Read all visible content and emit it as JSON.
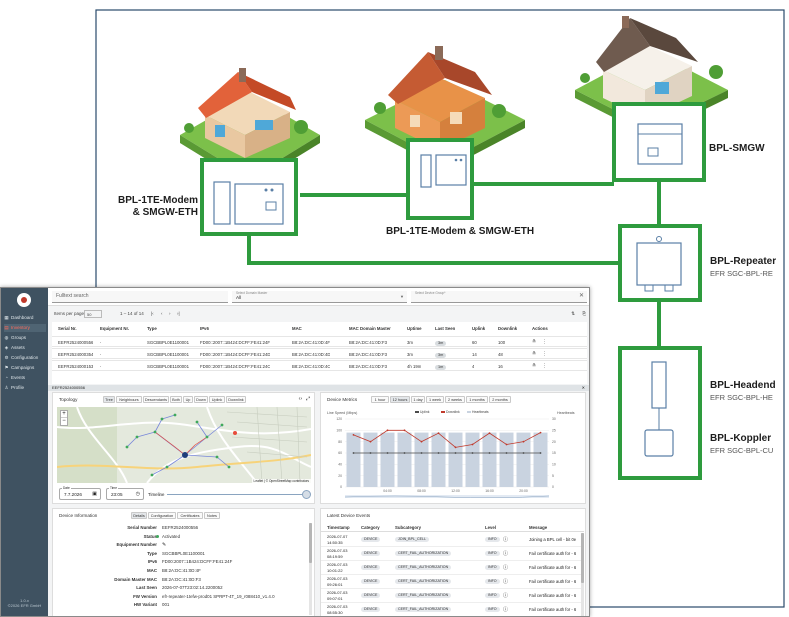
{
  "diagram": {
    "nodes": {
      "modem1": {
        "title_line1": "BPL-1TE-Modem",
        "title_line2": "& SMGW-ETH"
      },
      "modem2": {
        "title": "BPL-1TE-Modem & SMGW-ETH"
      },
      "smgw": {
        "title": "BPL-SMGW"
      },
      "repeater": {
        "title": "BPL-Repeater",
        "subtitle": "EFR SGC-BPL-RE"
      },
      "headend": {
        "title": "BPL-Headend",
        "subtitle": "EFR SGC-BPL-HE"
      },
      "koppler": {
        "title": "BPL-Koppler",
        "subtitle": "EFR SGC-BPL-CU"
      }
    },
    "colors": {
      "link": "#2e9b3e",
      "frame": "#2a4a6b"
    }
  },
  "app": {
    "sidebar": {
      "logo": "app-logo",
      "items": [
        {
          "label": "Dashboard",
          "icon": "dashboard-icon",
          "glyph": "▦"
        },
        {
          "label": "Inventory",
          "icon": "inventory-icon",
          "glyph": "▤"
        },
        {
          "label": "Groups",
          "icon": "groups-icon",
          "glyph": "◍"
        },
        {
          "label": "Assets",
          "icon": "assets-icon",
          "glyph": "◈"
        },
        {
          "label": "Configuration",
          "icon": "configuration-icon",
          "glyph": "⚙"
        },
        {
          "label": "Campaigns",
          "icon": "campaigns-icon",
          "glyph": "⚑"
        },
        {
          "label": "Events",
          "icon": "events-icon",
          "glyph": "◔"
        },
        {
          "label": "Profile",
          "icon": "profile-icon",
          "glyph": "♙"
        }
      ],
      "active_index": 1,
      "version": "1.0.x",
      "copyright": "©2026 EFR GmbH"
    },
    "topbar": {
      "search_placeholder": "Fulltext search",
      "domain_master_label": "Select Domain Master",
      "domain_master_value": "All",
      "device_group_label": "Select Device Group*",
      "device_group_value": ""
    },
    "pagination": {
      "items_per_page_label": "Items per page:",
      "items_per_page": "50",
      "range": "1 – 14 of 14"
    },
    "table": {
      "columns": [
        "Serial Nr.",
        "Equipment Nr.",
        "Type",
        "IPv6",
        "MAC",
        "MAC Domain Master",
        "Uptime",
        "Last Seen",
        "Uplink",
        "Downlink",
        "Actions"
      ],
      "rows": [
        {
          "serial": "EEFR2524000556",
          "equipment": "-",
          "type": "SGCBBPL0E1100001",
          "ipv6": "FD00::2007::1B424:DCFF:FE41:24F",
          "mac": "B8:2A:DC:41:0D:4F",
          "mac_dm": "B8:2A:DC:41:0D:F3",
          "uptime": "3m",
          "last_seen": "3m",
          "uplink": "60",
          "downlink": "100"
        },
        {
          "serial": "EEFR2524000354",
          "equipment": "-",
          "type": "SGCBBPL0E1100001",
          "ipv6": "FD00::2007::1B424:DCFF:FE41:24D",
          "mac": "B8:2A:DC:41:0D:4D",
          "mac_dm": "B8:2A:DC:41:0D:F3",
          "uptime": "3m",
          "last_seen": "3m",
          "uplink": "14",
          "downlink": "48"
        },
        {
          "serial": "EEFR2524000153",
          "equipment": "-",
          "type": "SGCBBPL0E1100001",
          "ipv6": "FD00::2007::1B424:DCFF:FE41:24C",
          "mac": "B8:2A:DC:41:0D:4C",
          "mac_dm": "B8:2A:DC:41:0D:F3",
          "uptime": "4h 19m",
          "last_seen": "1m",
          "uplink": "4",
          "downlink": "16"
        }
      ]
    },
    "selected_label": "EEFR2524000556",
    "topology": {
      "title": "Topology",
      "tabs": [
        "Tree",
        "Neighbours",
        "Descendants",
        "Both",
        "Up",
        "Down",
        "Uplink",
        "Downlink"
      ],
      "zoom_in": "+",
      "zoom_out": "−",
      "attribution": "Leaflet | © OpenStreetMap contributors",
      "date_label": "Date",
      "date_value": "7.7.2026",
      "time_label": "Time",
      "time_value": "23:05",
      "timeline_label": "Timeline"
    },
    "metrics": {
      "title": "Device Metrics",
      "ranges": [
        "1 hour",
        "12 hours",
        "1 day",
        "1 week",
        "2 weeks",
        "1 months",
        "2 months"
      ],
      "active_range": 1,
      "legend": [
        "Uplink",
        "Downlink",
        "Heartbeats"
      ],
      "y_left_label": "Line Speed (Mbps)",
      "y_right_label": "Heartbeats"
    },
    "info": {
      "title": "Device Information",
      "tabs": [
        "Details",
        "Configuration",
        "Certificates",
        "Notes"
      ],
      "fields": [
        {
          "k": "Serial Number",
          "v": "EEFR2524000556"
        },
        {
          "k": "Status",
          "v": "Activated"
        },
        {
          "k": "Equipment Number",
          "v": ""
        },
        {
          "k": "Type",
          "v": "SGCBBPL0E1100001"
        },
        {
          "k": "IPv6",
          "v": "FD00:2007::1B424:DCFF:FE41:24F"
        },
        {
          "k": "MAC",
          "v": "B8:2A:DC:41:0D:4F"
        },
        {
          "k": "Domain Master MAC",
          "v": "B8:2A:DC:41:0D:F3"
        },
        {
          "k": "Last Seen",
          "v": "2026-07-07T23:02:14.2200052"
        },
        {
          "k": "FW Version",
          "v": "efr-repeater-1tefw-prod01 SPRPT-4T_19_r088410_v1.4.0"
        },
        {
          "k": "HW Variant",
          "v": "001"
        }
      ]
    },
    "events": {
      "title": "Latest Device Events",
      "columns": [
        "Timestamp",
        "Category",
        "Subcategory",
        "Level",
        "Message"
      ],
      "rows": [
        {
          "ts": "2026-07-07 14:50:35",
          "cat": "DEVICE",
          "sub": "JOIN_BPL_CELL",
          "level": "INFO",
          "msg": "Joining a BPL cell - bit 0e"
        },
        {
          "ts": "2026-07-03 08:19:59",
          "cat": "DEVICE",
          "sub": "CERT_FAIL_AUTHORIZATION",
          "level": "INFO",
          "msg": "Fail certificate auth for - 6"
        },
        {
          "ts": "2026-07-03 10:01:22",
          "cat": "DEVICE",
          "sub": "CERT_FAIL_AUTHORIZATION",
          "level": "INFO",
          "msg": "Fail certificate auth for - 6"
        },
        {
          "ts": "2026-07-03 09:26:01",
          "cat": "DEVICE",
          "sub": "CERT_FAIL_AUTHORIZATION",
          "level": "INFO",
          "msg": "Fail certificate auth for - 6"
        },
        {
          "ts": "2026-07-03 09:07:01",
          "cat": "DEVICE",
          "sub": "CERT_FAIL_AUTHORIZATION",
          "level": "INFO",
          "msg": "Fail certificate auth for - 6"
        },
        {
          "ts": "2026-07-03 08:55:30",
          "cat": "DEVICE",
          "sub": "CERT_FAIL_AUTHORIZATION",
          "level": "INFO",
          "msg": "Fail certificate auth for - 6"
        }
      ]
    },
    "chart_data": {
      "type": "bar",
      "categories": [
        "00:00",
        "02:00",
        "04:00",
        "06:00",
        "08:00",
        "10:00",
        "12:00",
        "14:00",
        "16:00",
        "18:00",
        "20:00",
        "22:00"
      ],
      "series": [
        {
          "name": "Heartbeats",
          "values": [
            24,
            24,
            24,
            24,
            24,
            24,
            24,
            24,
            24,
            24,
            24,
            24
          ]
        },
        {
          "name": "Uplink",
          "values": [
            60,
            60,
            60,
            60,
            60,
            60,
            60,
            60,
            60,
            60,
            60,
            60
          ]
        },
        {
          "name": "Downlink",
          "values": [
            92,
            80,
            100,
            100,
            80,
            95,
            70,
            75,
            95,
            75,
            80,
            96
          ]
        }
      ],
      "ylim": [
        0,
        120
      ],
      "y2lim": [
        0,
        30
      ],
      "y_ticks": [
        "0",
        "20",
        "40",
        "60",
        "80",
        "100",
        "120"
      ],
      "y2_ticks": [
        "0",
        "5",
        "10",
        "15",
        "20",
        "25",
        "30"
      ],
      "x_tick_labels": [
        "04:00",
        "08:00",
        "12:00",
        "16:00",
        "20:00"
      ],
      "ylabel": "Line Speed (Mbps)",
      "y2label": "Heartbeats",
      "legend": "top-center",
      "grid": true
    }
  }
}
